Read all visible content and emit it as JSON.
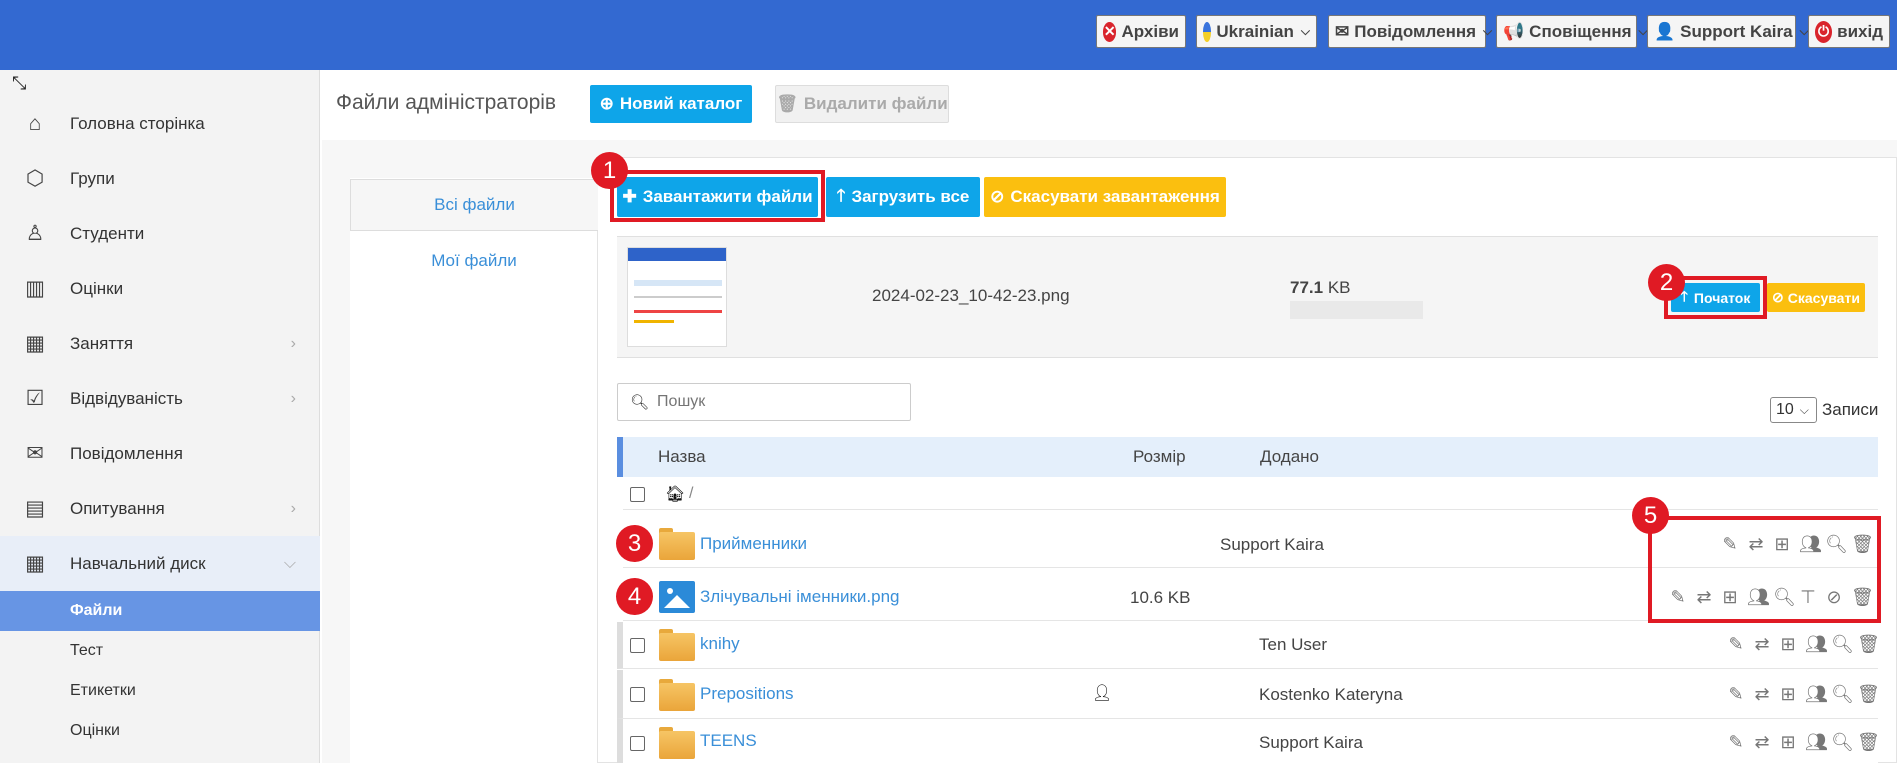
{
  "topbar": {
    "archives": "Архіви",
    "language": "Ukrainian",
    "messages": "Повідомлення",
    "notifications": "Сповіщення",
    "user": "Support Kaira",
    "logout": "вихід",
    "color": "#3369d1"
  },
  "sidebar": {
    "items": [
      {
        "label": "Головна сторінка",
        "icon": "home-icon"
      },
      {
        "label": "Групи",
        "icon": "cube-icon"
      },
      {
        "label": "Студенти",
        "icon": "user-icon"
      },
      {
        "label": "Оцінки",
        "icon": "grades-icon"
      },
      {
        "label": "Заняття",
        "icon": "calendar-icon"
      },
      {
        "label": "Відвідуваність",
        "icon": "checkbox-icon"
      },
      {
        "label": "Повідомлення",
        "icon": "envelope-icon"
      },
      {
        "label": "Опитування",
        "icon": "survey-icon"
      },
      {
        "label": "Навчальний диск",
        "icon": "calendar-icon"
      }
    ],
    "sub_items": [
      "Файли",
      "Тест",
      "Етикетки",
      "Оцінки"
    ]
  },
  "header": {
    "title": "Файли адміністраторів",
    "new_folder": "Новий каталог",
    "delete_files": "Видалити файли"
  },
  "tabs": {
    "all": "Всі файли",
    "mine": "Мої файли"
  },
  "upload": {
    "upload_files": "Завантажити файли",
    "upload_all": "Загрузить все",
    "cancel_upload": "Скасувати завантаження",
    "file_name": "2024-02-23_10-42-23.png",
    "file_size_value": "77.1",
    "file_size_unit": "KB",
    "start": "Початок",
    "cancel": "Скасувати"
  },
  "search": {
    "placeholder": "Пошук"
  },
  "per_page": {
    "value": "10",
    "label": "Записи"
  },
  "table": {
    "headers": [
      "Назва",
      "Розмір",
      "Додано"
    ],
    "breadcrumb": "/",
    "rows": [
      {
        "name": "Прийменники",
        "size": "",
        "added": "Support Kaira",
        "type": "folder"
      },
      {
        "name": "Злічувальні іменники.png",
        "size": "10.6 KB",
        "added": "",
        "type": "image"
      },
      {
        "name": "knihy",
        "size": "",
        "added": "Ten User",
        "type": "folder"
      },
      {
        "name": "Prepositions",
        "size": "",
        "added": "Kostenko Kateryna",
        "type": "folder"
      },
      {
        "name": "TEENS",
        "size": "",
        "added": "Support Kaira",
        "type": "folder"
      }
    ]
  },
  "annotations": [
    "1",
    "2",
    "3",
    "4",
    "5"
  ]
}
